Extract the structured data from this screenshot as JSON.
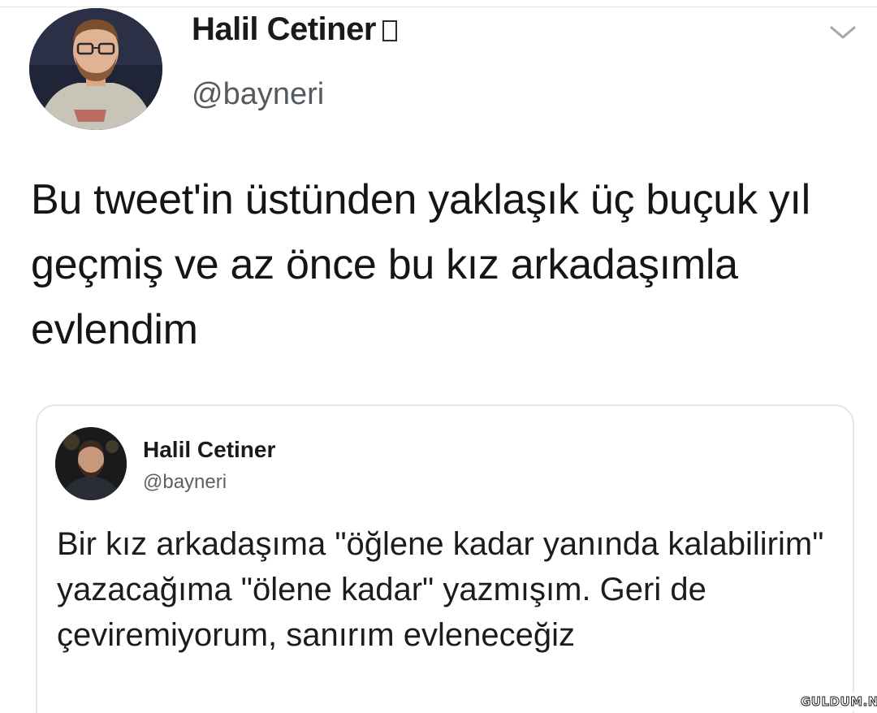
{
  "tweet": {
    "author": {
      "name": "Halil Cetiner",
      "verified_glyph": "",
      "handle": "@bayneri",
      "avatar": "avatar-photo"
    },
    "menu_icon": "chevron-down-icon",
    "text": "Bu tweet'in üstünden yaklaşık üç buçuk yıl geçmiş ve az önce bu kız arkadaşımla evlendim"
  },
  "quoted_tweet": {
    "author": {
      "name": "Halil Cetiner",
      "handle": "@bayneri",
      "avatar": "avatar-photo"
    },
    "text": "Bir kız arkadaşıma \"öğlene kadar yanında kalabilirim\" yazacağıma \"ölene kadar\" yazmışım. Geri de çeviremiyorum, sanırım evleneceğiz"
  },
  "watermark": {
    "text": "GULDUM.NET"
  }
}
